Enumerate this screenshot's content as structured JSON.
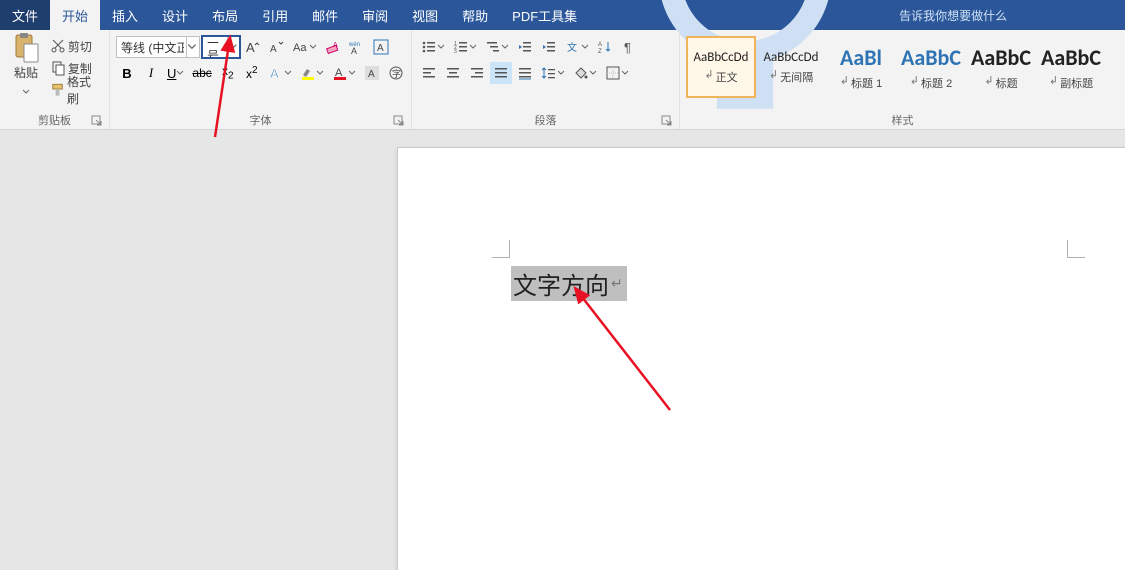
{
  "tabs": {
    "file": "文件",
    "home": "开始",
    "insert": "插入",
    "design": "设计",
    "layout": "布局",
    "references": "引用",
    "mailings": "邮件",
    "review": "审阅",
    "view": "视图",
    "help": "帮助",
    "pdftools": "PDF工具集"
  },
  "tellme": "告诉我你想要做什么",
  "clipboard": {
    "paste": "粘贴",
    "cut": "剪切",
    "copy": "复制",
    "formatPainter": "格式刷",
    "groupLabel": "剪贴板"
  },
  "font": {
    "name": "等线 (中文正文)",
    "size": "二号",
    "groupLabel": "字体"
  },
  "paragraph": {
    "groupLabel": "段落"
  },
  "styles": {
    "groupLabel": "样式",
    "items": [
      {
        "preview": "AaBbCcDd",
        "name": "正文",
        "cls": "n",
        "sel": true
      },
      {
        "preview": "AaBbCcDd",
        "name": "无间隔",
        "cls": "n"
      },
      {
        "preview": "AaBl",
        "name": "标题 1",
        "cls": "h blue"
      },
      {
        "preview": "AaBbC",
        "name": "标题 2",
        "cls": "h blue"
      },
      {
        "preview": "AaBbC",
        "name": "标题",
        "cls": "h"
      },
      {
        "preview": "AaBbC",
        "name": "副标题",
        "cls": "h"
      }
    ]
  },
  "doc": {
    "selectedText": "文字方向"
  }
}
